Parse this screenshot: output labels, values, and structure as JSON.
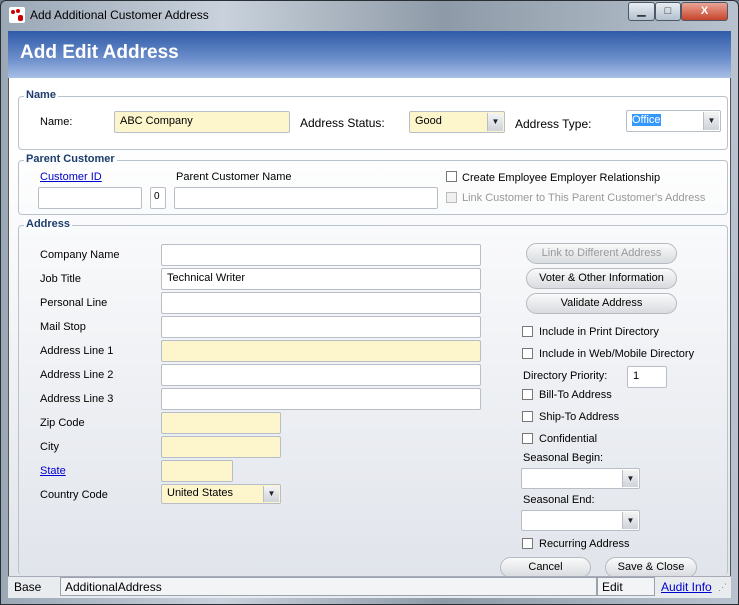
{
  "window": {
    "title": "Add Additional Customer Address",
    "minimize": "▁",
    "maximize": "□",
    "close": "X"
  },
  "header": {
    "title": "Add Edit Address"
  },
  "name_group": {
    "legend": "Name",
    "name_label": "Name:",
    "name_value": "ABC Company",
    "status_label": "Address Status:",
    "status_value": "Good",
    "type_label": "Address Type:",
    "type_value": "Office"
  },
  "parent_group": {
    "legend": "Parent Customer",
    "customer_id_label": "Customer ID",
    "customer_id_value": "",
    "zero_button": "0",
    "parent_name_label": "Parent Customer Name",
    "parent_name_value": "",
    "create_relationship": "Create Employee Employer Relationship",
    "link_customer": "Link Customer to This Parent Customer's Address"
  },
  "address_group": {
    "legend": "Address",
    "fields": [
      {
        "label": "Company Name",
        "value": ""
      },
      {
        "label": "Job Title",
        "value": "Technical Writer"
      },
      {
        "label": "Personal Line",
        "value": ""
      },
      {
        "label": "Mail Stop",
        "value": ""
      },
      {
        "label": "Address Line 1",
        "value": ""
      },
      {
        "label": "Address Line 2",
        "value": ""
      },
      {
        "label": "Address Line 3",
        "value": ""
      },
      {
        "label": "Zip Code",
        "value": ""
      },
      {
        "label": "City",
        "value": ""
      },
      {
        "label": "State",
        "value": ""
      },
      {
        "label": "Country Code",
        "value": "United States"
      }
    ],
    "link_different": "Link to Different Address",
    "voter_info": "Voter & Other Information",
    "validate": "Validate Address",
    "print_dir": "Include in Print Directory",
    "web_dir": "Include in Web/Mobile Directory",
    "dir_priority_label": "Directory Priority:",
    "dir_priority_value": "1",
    "bill_to": "Bill-To Address",
    "ship_to": "Ship-To Address",
    "confidential": "Confidential",
    "seasonal_begin": "Seasonal Begin:",
    "seasonal_end": "Seasonal End:",
    "recurring": "Recurring Address",
    "cancel": "Cancel",
    "save_close": "Save & Close"
  },
  "statusbar": {
    "base": "Base",
    "object": "AdditionalAddress",
    "mode": "Edit",
    "audit": "Audit Info"
  }
}
